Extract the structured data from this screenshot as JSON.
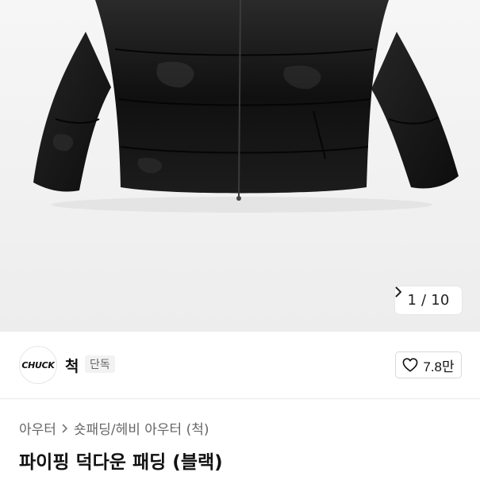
{
  "gallery": {
    "image_alt_icon": "puffer-jacket-image",
    "current": "1",
    "total": "10",
    "counter_text": "1 / 10"
  },
  "brand": {
    "logo_text": "CHUCK",
    "name": "척",
    "badge": "단독"
  },
  "like": {
    "icon": "heart-icon",
    "count": "7.8만"
  },
  "breadcrumb": {
    "items": [
      "아우터",
      "숏패딩/헤비 아우터 (척)"
    ]
  },
  "product": {
    "title": "파이핑 덕다운 패딩 (블랙)"
  },
  "colors": {
    "jacket": "#161616",
    "background": "#f2f2f2",
    "text_primary": "#111111",
    "text_secondary": "#666666"
  }
}
